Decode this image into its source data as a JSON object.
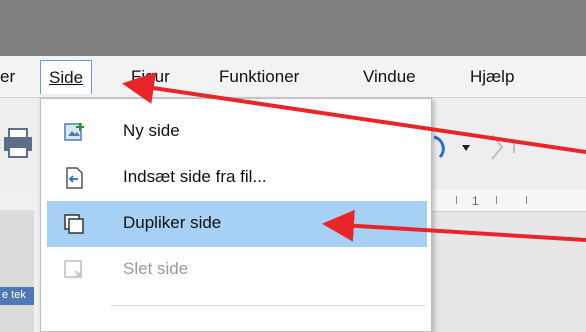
{
  "menubar": {
    "items": [
      {
        "label": "er"
      },
      {
        "label": "Side"
      },
      {
        "label": "Figur"
      },
      {
        "label": "Funktioner"
      },
      {
        "label": "Vindue"
      },
      {
        "label": "Hjælp"
      }
    ]
  },
  "dropdown": {
    "items": [
      {
        "label": "Ny side",
        "icon": "new-page-icon",
        "disabled": false,
        "highlighted": false
      },
      {
        "label": "Indsæt side fra fil...",
        "icon": "insert-page-from-file-icon",
        "disabled": false,
        "highlighted": false
      },
      {
        "label": "Dupliker side",
        "icon": "duplicate-page-icon",
        "disabled": false,
        "highlighted": true
      },
      {
        "label": "Slet side",
        "icon": "delete-page-icon",
        "disabled": true,
        "highlighted": false
      }
    ]
  },
  "ruler": {
    "ticks": [
      "1"
    ]
  },
  "left_pane": {
    "text": "e tek"
  },
  "colors": {
    "titlebar": "#7f7f7f",
    "highlight": "#a7d1f4",
    "arrow": "#e8262a",
    "menu_active_border": "#5f9ed9"
  }
}
